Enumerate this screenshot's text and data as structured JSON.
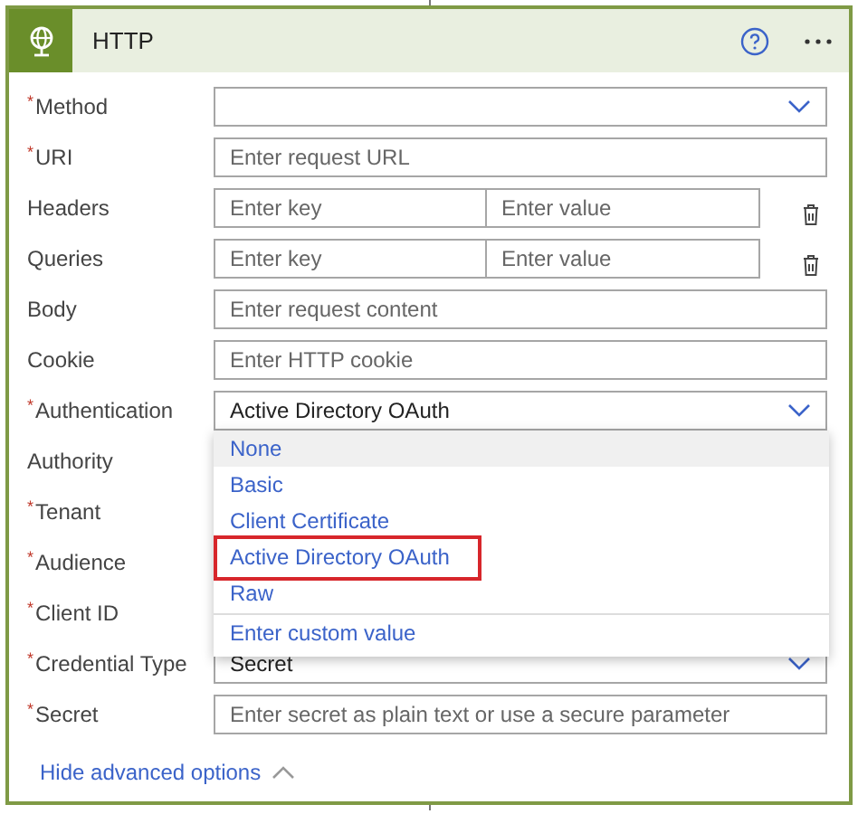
{
  "header": {
    "title": "HTTP"
  },
  "fields": [
    {
      "kind": "select",
      "label": "Method",
      "required_mark": "*"
    },
    {
      "kind": "text",
      "label": "URI",
      "required_mark": "*",
      "placeholder": "Enter request URL"
    },
    {
      "kind": "pair",
      "label": "Headers",
      "key_placeholder": "Enter key",
      "value_placeholder": "Enter value"
    },
    {
      "kind": "pair",
      "label": "Queries",
      "key_placeholder": "Enter key",
      "value_placeholder": "Enter value"
    },
    {
      "kind": "text",
      "label": "Body",
      "placeholder": "Enter request content"
    },
    {
      "kind": "text",
      "label": "Cookie",
      "placeholder": "Enter HTTP cookie"
    },
    {
      "kind": "select",
      "label": "Authentication",
      "required_mark": "*",
      "value": "Active Directory OAuth",
      "expanded": true
    },
    {
      "kind": "covered",
      "label": "Authority"
    },
    {
      "kind": "covered",
      "label": "Tenant",
      "required_mark": "*"
    },
    {
      "kind": "covered",
      "label": "Audience",
      "required_mark": "*"
    },
    {
      "kind": "covered",
      "label": "Client ID",
      "required_mark": "*"
    },
    {
      "kind": "select",
      "label": "Credential Type",
      "required_mark": "*",
      "value": "Secret"
    },
    {
      "kind": "text",
      "label": "Secret",
      "required_mark": "*",
      "placeholder": "Enter secret as plain text or use a secure parameter"
    }
  ],
  "dropdown": {
    "options": [
      {
        "label": "None",
        "hovered": true,
        "outlined": false
      },
      {
        "label": "Basic",
        "hovered": false,
        "outlined": false
      },
      {
        "label": "Client Certificate",
        "hovered": false,
        "outlined": false
      },
      {
        "label": "Active Directory OAuth",
        "hovered": false,
        "outlined": true
      },
      {
        "label": "Raw",
        "hovered": false,
        "outlined": false
      }
    ],
    "custom": "Enter custom value"
  },
  "footer": {
    "link": "Hide advanced options",
    "expanded": true
  }
}
